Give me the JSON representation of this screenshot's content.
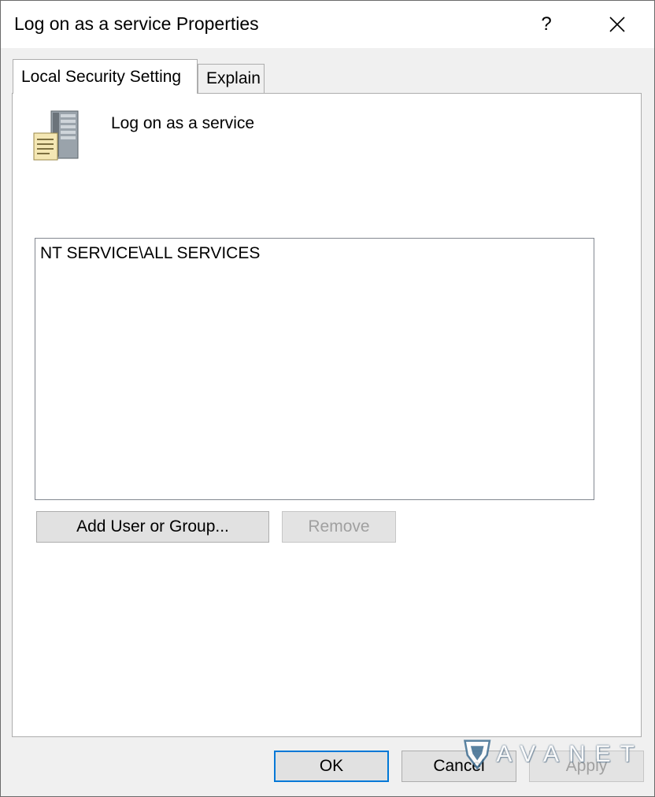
{
  "window": {
    "title": "Log on as a service Properties",
    "help_label": "?"
  },
  "tabs": [
    {
      "label": "Local Security Setting",
      "active": true
    },
    {
      "label": "Explain",
      "active": false
    }
  ],
  "policy": {
    "icon": "server-document-icon",
    "name": "Log on as a service"
  },
  "members_list": {
    "items": [
      "NT SERVICE\\ALL SERVICES"
    ]
  },
  "actions": {
    "add_label": "Add User or Group...",
    "remove_label": "Remove"
  },
  "footer": {
    "ok_label": "OK",
    "cancel_label": "Cancel",
    "apply_label": "Apply"
  },
  "watermark": {
    "text": "AVANET"
  },
  "colors": {
    "focus_accent": "#0078d7",
    "dialog_bg": "#f0f0f0",
    "disabled_text": "#a0a0a0"
  }
}
